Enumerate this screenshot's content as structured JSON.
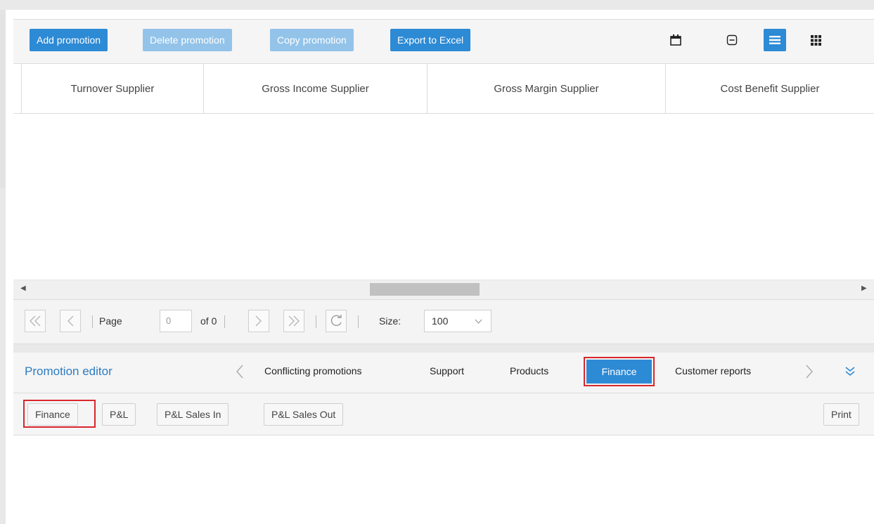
{
  "toolbar": {
    "add_label": "Add promotion",
    "delete_label": "Delete promotion",
    "copy_label": "Copy promotion",
    "export_label": "Export to Excel",
    "icons": [
      "calendar-icon",
      "collapse-icon",
      "list-view-icon",
      "grid-view-icon"
    ]
  },
  "grid": {
    "columns": [
      "Turnover Supplier",
      "Gross Income Supplier",
      "Gross Margin Supplier",
      "Cost Benefit Supplier"
    ],
    "rows": []
  },
  "pager": {
    "page_label": "Page",
    "page_value": "0",
    "of_label": "of 0",
    "size_label": "Size:",
    "size_value": "100"
  },
  "editor": {
    "title": "Promotion editor",
    "tabs": [
      "Conflicting promotions",
      "Support",
      "Products",
      "Finance",
      "Customer reports"
    ],
    "active_tab": "Finance",
    "subtabs": [
      "Finance",
      "P&L",
      "P&L Sales In",
      "P&L Sales Out"
    ],
    "active_subtab": "Finance",
    "print_label": "Print"
  },
  "colors": {
    "accent": "#2d8ad5",
    "accent_disabled": "#93c3e9",
    "highlight": "#d9262c",
    "title_blue": "#2d7cc1"
  }
}
